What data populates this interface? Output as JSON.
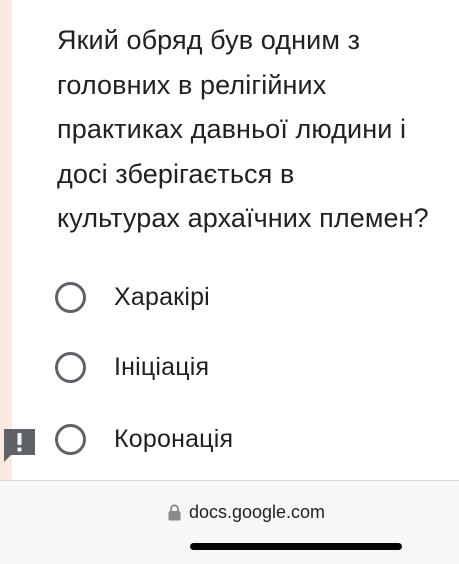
{
  "question": {
    "lines": [
      "Який обряд був одним з",
      "головних в релігійних",
      "практиках давньої людини і",
      "досі зберігається в",
      "культурах архаїчних племен?"
    ]
  },
  "options": [
    {
      "label": "Харакірі",
      "selected": false
    },
    {
      "label": "Ініціація",
      "selected": false
    },
    {
      "label": "Коронація",
      "selected": false
    }
  ],
  "report_badge": {
    "icon": "exclamation-icon",
    "color": "#5f6368"
  },
  "browser": {
    "url": "docs.google.com",
    "icon": "lock-icon"
  },
  "colors": {
    "accent_strip": "#fbe9e2",
    "radio": "#5f6368",
    "text": "#202124"
  }
}
